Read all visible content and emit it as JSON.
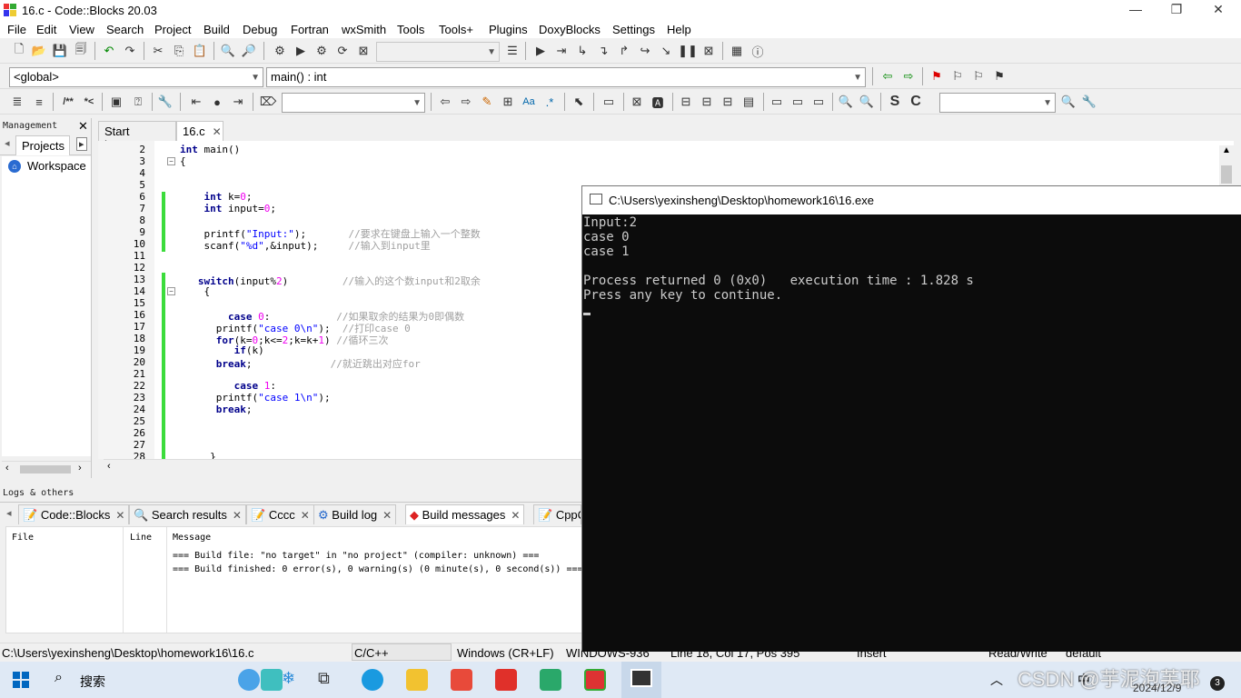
{
  "window": {
    "title": "16.c - Code::Blocks 20.03"
  },
  "menu": [
    "File",
    "Edit",
    "View",
    "Search",
    "Project",
    "Build",
    "Debug",
    "Fortran",
    "wxSmith",
    "Tools",
    "Tools+",
    "Plugins",
    "DoxyBlocks",
    "Settings",
    "Help"
  ],
  "toolbar2": {
    "scope": "<global>",
    "function": "main() : int"
  },
  "management": {
    "header": "Management",
    "tab": "Projects",
    "item": "Workspace"
  },
  "editor": {
    "tabs": [
      {
        "label": "Start here"
      },
      {
        "label": "16.c"
      }
    ],
    "lines": [
      {
        "n": "2",
        "html": "<span class=\"kw\">int</span> main()"
      },
      {
        "n": "3",
        "html": "{"
      },
      {
        "n": "4",
        "html": ""
      },
      {
        "n": "5",
        "html": ""
      },
      {
        "n": "6",
        "html": "    <span class=\"kw\">int</span> k=<span class=\"num\">0</span>;"
      },
      {
        "n": "7",
        "html": "    <span class=\"kw\">int</span> input=<span class=\"num\">0</span>;"
      },
      {
        "n": "8",
        "html": ""
      },
      {
        "n": "9",
        "html": "    printf(<span class=\"str\">\"Input:\"</span>);       <span class=\"cmt\">//要求在键盘上输入一个整数</span>"
      },
      {
        "n": "10",
        "html": "    scanf(<span class=\"str\">\"%d\"</span>,&amp;input);     <span class=\"cmt\">//输入到input里</span>"
      },
      {
        "n": "11",
        "html": ""
      },
      {
        "n": "12",
        "html": ""
      },
      {
        "n": "13",
        "html": "   <span class=\"kw\">switch</span>(input%<span class=\"num\">2</span>)         <span class=\"cmt\">//输入的这个数input和2取余</span>"
      },
      {
        "n": "14",
        "html": "    {"
      },
      {
        "n": "15",
        "html": ""
      },
      {
        "n": "16",
        "html": "        <span class=\"kw\">case</span> <span class=\"num\">0</span>:           <span class=\"cmt\">//如果取余的结果为0即偶数</span>"
      },
      {
        "n": "17",
        "html": "      printf(<span class=\"str\">\"case 0\\n\"</span>);  <span class=\"cmt\">//打印case 0</span>"
      },
      {
        "n": "18",
        "html": "      <span class=\"kw\">for</span>(k=<span class=\"num\">0</span>;k&lt;=<span class=\"num\">2</span>;k=k+<span class=\"num\">1</span>) <span class=\"cmt\">//循环三次</span>"
      },
      {
        "n": "19",
        "html": "         <span class=\"kw\">if</span>(k)"
      },
      {
        "n": "20",
        "html": "      <span class=\"kw\">break</span>;             <span class=\"cmt\">//就近跳出对应for</span>"
      },
      {
        "n": "21",
        "html": ""
      },
      {
        "n": "22",
        "html": "         <span class=\"kw\">case</span> <span class=\"num\">1</span>:"
      },
      {
        "n": "23",
        "html": "      printf(<span class=\"str\">\"case 1\\n\"</span>);"
      },
      {
        "n": "24",
        "html": "      <span class=\"kw\">break</span>;"
      },
      {
        "n": "25",
        "html": ""
      },
      {
        "n": "26",
        "html": ""
      },
      {
        "n": "27",
        "html": ""
      },
      {
        "n": "28",
        "html": "     }"
      }
    ]
  },
  "logs": {
    "header": "Logs & others",
    "tabs": [
      "Code::Blocks",
      "Search results",
      "Cccc",
      "Build log",
      "Build messages",
      "CppC"
    ],
    "columns": [
      "File",
      "Line",
      "Message"
    ],
    "messages": [
      "=== Build file: \"no target\" in \"no project\" (compiler: unknown) ===",
      "=== Build finished: 0 error(s), 0 warning(s) (0 minute(s), 0 second(s)) ==="
    ]
  },
  "status": {
    "path": "C:\\Users\\yexinsheng\\Desktop\\homework16\\16.c",
    "lang": "C/C++",
    "eol": "Windows (CR+LF)",
    "enc": "WINDOWS-936",
    "pos": "Line 18, Col 17, Pos 395",
    "mode": "Insert",
    "rw": "Read/Write",
    "profile": "default"
  },
  "console": {
    "title": "C:\\Users\\yexinsheng\\Desktop\\homework16\\16.exe",
    "lines": [
      "Input:2",
      "case 0",
      "case 1",
      "",
      "Process returned 0 (0x0)   execution time : 1.828 s",
      "Press any key to continue."
    ]
  },
  "taskbar": {
    "search": "搜索",
    "lang": "中",
    "watermark": "CSDN @芋泥泡芙耶",
    "date": "2024/12/9",
    "badge": "3"
  }
}
